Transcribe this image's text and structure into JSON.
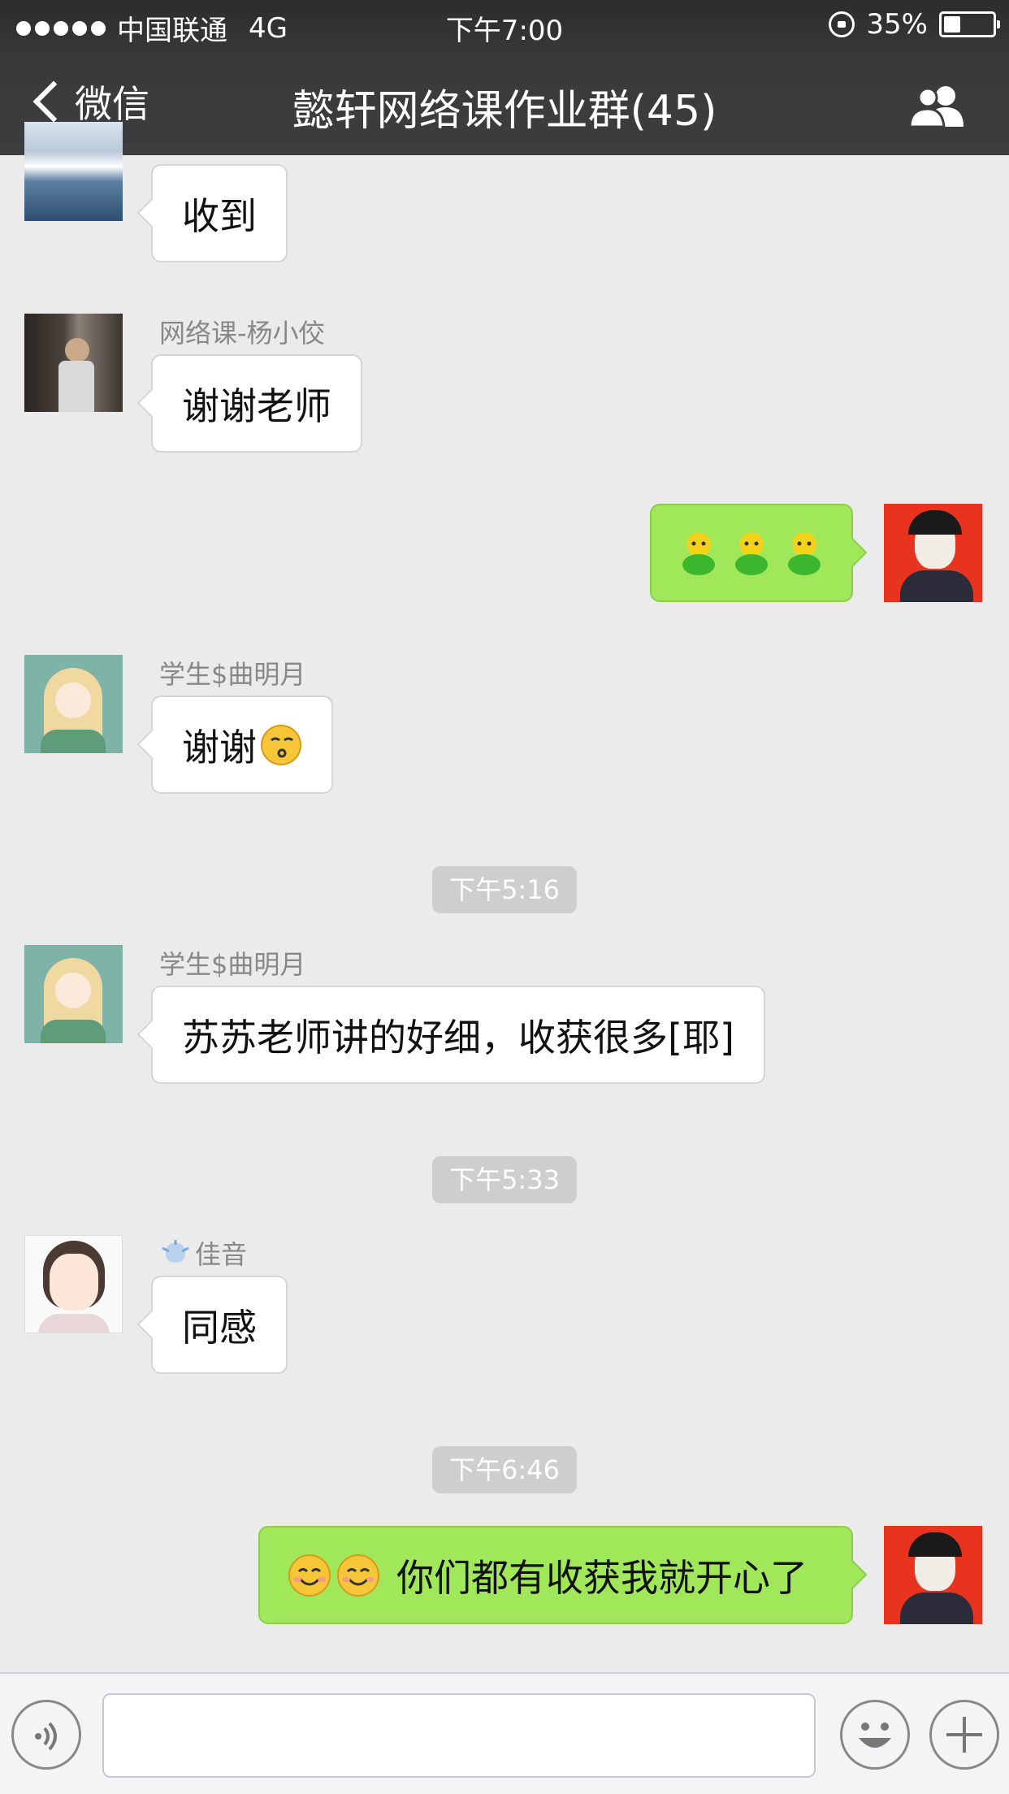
{
  "status_bar": {
    "carrier": "中国联通",
    "network": "4G",
    "time": "下午7:00",
    "battery_text": "35%",
    "battery_level": 0.35
  },
  "nav": {
    "back_label": "微信",
    "title": "懿轩网络课作业群(45)"
  },
  "messages": [
    {
      "text": "收到"
    },
    {
      "sender": "网络课-杨小佼",
      "text": "谢谢老师"
    },
    {
      "emoji_icon": "green-chick-emoji"
    },
    {
      "sender": "学生$曲明月",
      "text": "谢谢",
      "emoji_icon": "kiss-emoji"
    },
    {
      "sender": "学生$曲明月",
      "text": "苏苏老师讲的好细，收获很多[耶]"
    },
    {
      "sender": "佳音",
      "text": "同感"
    },
    {
      "text": "你们都有收获我就开心了",
      "emoji_icon": "smile-emoji"
    }
  ],
  "timestamps": [
    "下午5:16",
    "下午5:33",
    "下午6:46"
  ],
  "colors": {
    "header_bg": "#3a3a3a",
    "chat_bg": "#ebebeb",
    "outgoing_bubble": "#a0e75a",
    "incoming_bubble": "#ffffff"
  }
}
